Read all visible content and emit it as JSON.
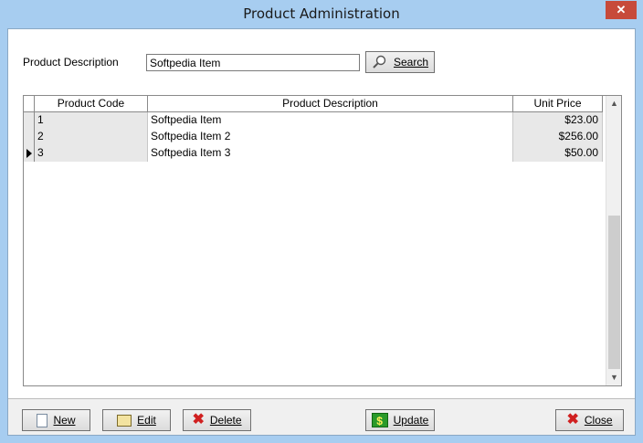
{
  "window": {
    "title": "Product Administration",
    "close_glyph": "✕"
  },
  "search": {
    "label": "Product Description",
    "value": "Softpedia Item",
    "button_label": "Search",
    "button_icon": "magnifier-icon"
  },
  "grid": {
    "columns": [
      "Product Code",
      "Product Description",
      "Unit Price"
    ],
    "rows": [
      {
        "code": "1",
        "description": "Softpedia Item",
        "price": "$23.00"
      },
      {
        "code": "2",
        "description": "Softpedia Item 2",
        "price": "$256.00"
      },
      {
        "code": "3",
        "description": "Softpedia Item 3",
        "price": "$50.00"
      }
    ],
    "current_row_index": 2,
    "scroll_up_glyph": "▲",
    "scroll_down_glyph": "▼"
  },
  "buttons": {
    "new": "New",
    "edit": "Edit",
    "delete": "Delete",
    "update": "Update",
    "close": "Close"
  },
  "icons": {
    "new": "document-icon",
    "edit": "edit-icon",
    "delete": "delete-x-icon",
    "update": "dollar-icon",
    "close": "close-x-icon"
  },
  "colors": {
    "title_bar": "#a7cdf0",
    "delete_red": "#d02020",
    "update_green": "#2a9a2a"
  }
}
